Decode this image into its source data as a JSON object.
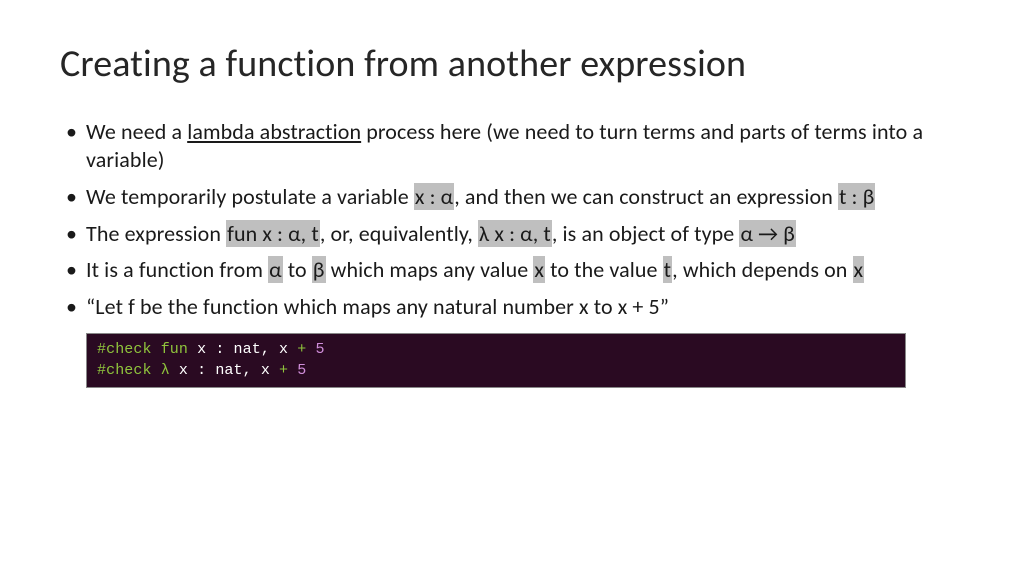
{
  "title": "Creating a function from another expression",
  "b1": {
    "a": "We need a ",
    "u": "lambda abstraction",
    "b": " process here (we need to turn terms and parts of terms into a variable)"
  },
  "b2": {
    "a": "We temporarily postulate a variable  ",
    "h1": "x : α",
    "b": ", and then we can construct an expression ",
    "h2": "t : β"
  },
  "b3": {
    "a": "The expression  ",
    "h1": "fun x : α, t",
    "b": ", or, equivalently, ",
    "h2": "λ x : α, t",
    "c": ", is an object of type ",
    "h3": "α → β"
  },
  "b4": {
    "a": "It is a function from ",
    "h1": "α",
    "b": " to ",
    "h2": "β",
    "c": " which maps any value ",
    "h3": "x",
    "d": " to the value ",
    "h4": "t",
    "e": ", which depends on ",
    "h5": "x"
  },
  "b5": "“Let f be the function which maps any natural number x to x + 5”",
  "code": {
    "l1": {
      "kw": "#check fun ",
      "var": "x : nat, x ",
      "op": "+ ",
      "num": "5"
    },
    "l2": {
      "kw": "#check λ ",
      "var": "x : nat, x ",
      "op": "+ ",
      "num": "5"
    }
  }
}
